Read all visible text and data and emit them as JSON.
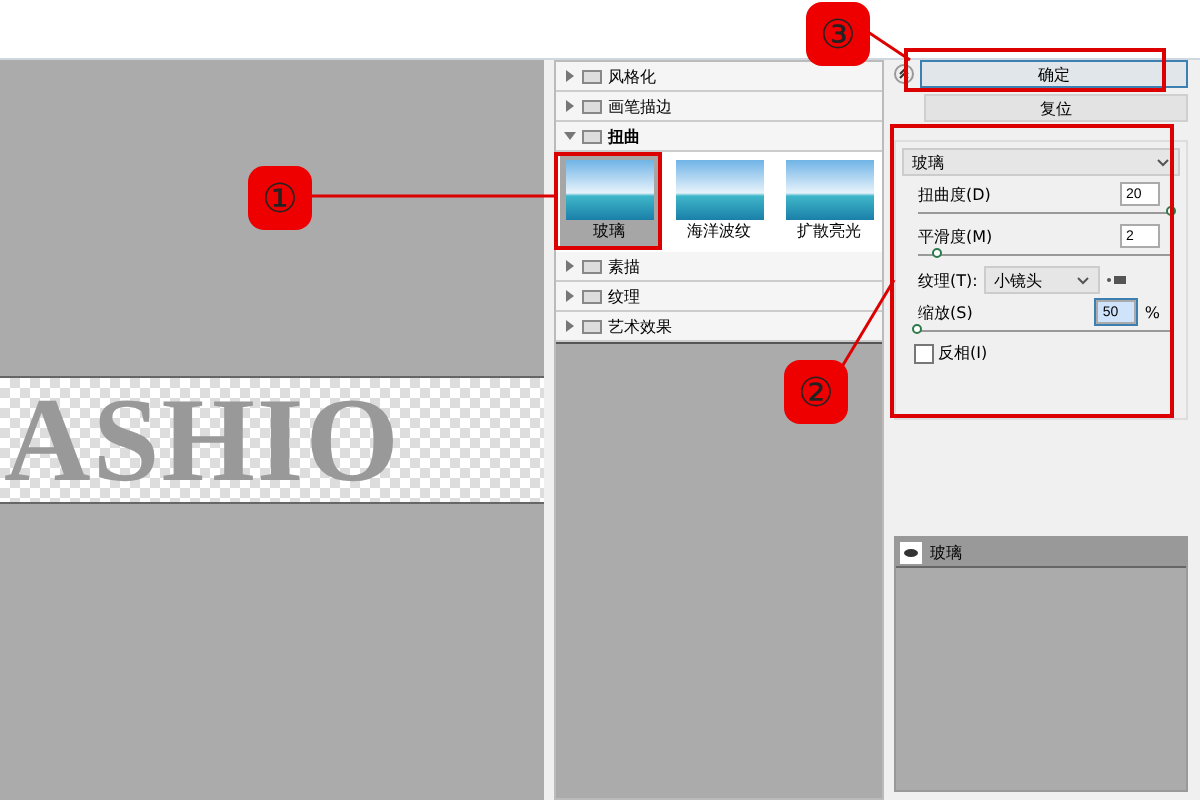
{
  "preview": {
    "text": "ASHIO"
  },
  "categories": [
    {
      "label": "风格化",
      "expanded": false
    },
    {
      "label": "画笔描边",
      "expanded": false
    },
    {
      "label": "扭曲",
      "expanded": true,
      "filters": [
        {
          "label": "玻璃",
          "selected": true
        },
        {
          "label": "海洋波纹",
          "selected": false
        },
        {
          "label": "扩散亮光",
          "selected": false
        }
      ]
    },
    {
      "label": "素描",
      "expanded": false
    },
    {
      "label": "纹理",
      "expanded": false
    },
    {
      "label": "艺术效果",
      "expanded": false
    }
  ],
  "buttons": [
    {
      "label": "确定",
      "kind": "primary"
    },
    {
      "label": "复位",
      "kind": "plain"
    }
  ],
  "filter_select": {
    "value": "玻璃"
  },
  "params": [
    {
      "kind": "slider",
      "label": "扭曲度(D)",
      "value": "20",
      "level": 1.0
    },
    {
      "kind": "slider",
      "label": "平滑度(M)",
      "value": "2",
      "level": 0.08
    },
    {
      "kind": "select",
      "label": "纹理(T):",
      "value": "小镜头"
    },
    {
      "kind": "slider",
      "label": "缩放(S)",
      "value": "50",
      "unit": "%",
      "level": 0.0,
      "focused": true
    },
    {
      "kind": "checkbox",
      "label": "反相(I)",
      "checked": false
    }
  ],
  "layers": [
    {
      "label": "玻璃",
      "visible": true
    }
  ],
  "annotations": [
    {
      "label": "③"
    },
    {
      "label": "①"
    },
    {
      "label": "②"
    }
  ]
}
